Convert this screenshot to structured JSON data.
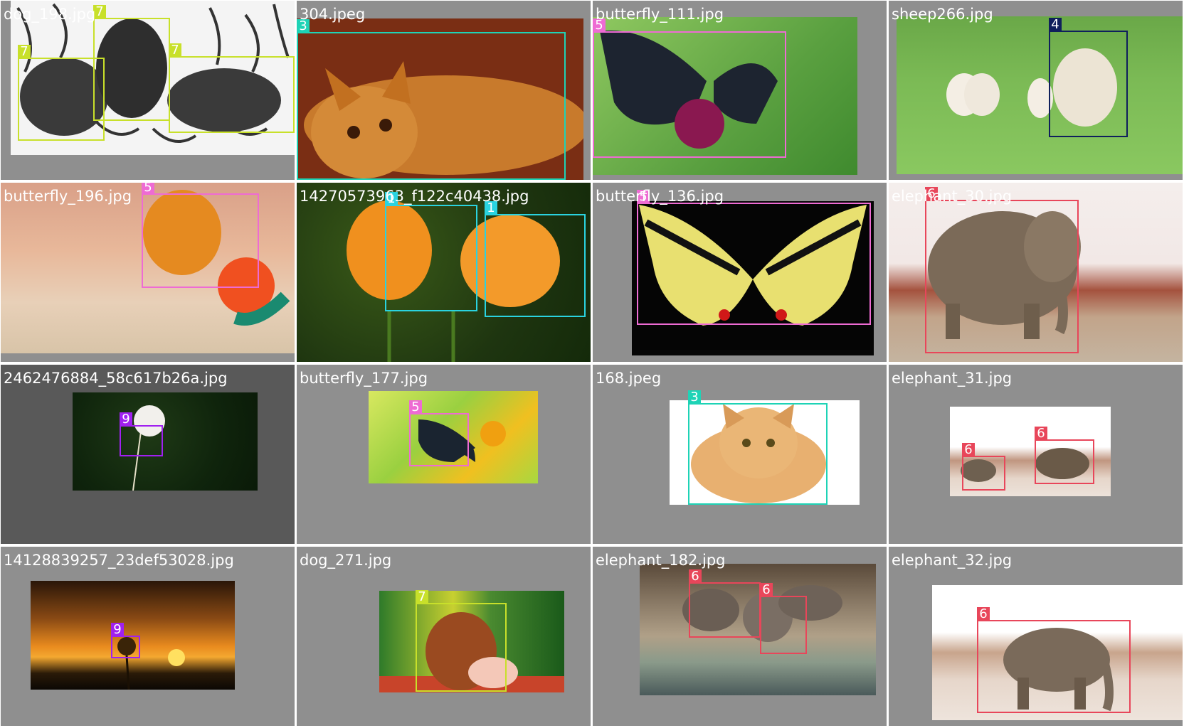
{
  "class_colors": {
    "1": "#2ad3e0",
    "3": "#1ed3b6",
    "4": "#0f1f5c",
    "5": "#ee6bd3",
    "6": "#e8465a",
    "7": "#c8e02a",
    "9": "#a020f0"
  },
  "tiles": [
    {
      "filename": "dog_198.jpg",
      "labels": [
        "7",
        "7",
        "7"
      ]
    },
    {
      "filename": "304.jpeg",
      "labels": [
        "3"
      ]
    },
    {
      "filename": "butterfly_111.jpg",
      "labels": [
        "5"
      ]
    },
    {
      "filename": "sheep266.jpg",
      "labels": [
        "4"
      ]
    },
    {
      "filename": "butterfly_196.jpg",
      "labels": [
        "5"
      ]
    },
    {
      "filename": "14270573963_f122c40438.jpg",
      "labels": [
        "1",
        "1"
      ]
    },
    {
      "filename": "butterfly_136.jpg",
      "labels": [
        "5"
      ]
    },
    {
      "filename": "elephant_30.jpg",
      "labels": [
        "6"
      ]
    },
    {
      "filename": "2462476884_58c617b26a.jpg",
      "labels": [
        "9"
      ]
    },
    {
      "filename": "butterfly_177.jpg",
      "labels": [
        "5"
      ]
    },
    {
      "filename": "168.jpeg",
      "labels": [
        "3"
      ]
    },
    {
      "filename": "elephant_31.jpg",
      "labels": [
        "6",
        "6"
      ]
    },
    {
      "filename": "14128839257_23def53028.jpg",
      "labels": [
        "9"
      ]
    },
    {
      "filename": "dog_271.jpg",
      "labels": [
        "7"
      ]
    },
    {
      "filename": "elephant_182.jpg",
      "labels": [
        "6",
        "6"
      ]
    },
    {
      "filename": "elephant_32.jpg",
      "labels": [
        "6"
      ]
    }
  ]
}
